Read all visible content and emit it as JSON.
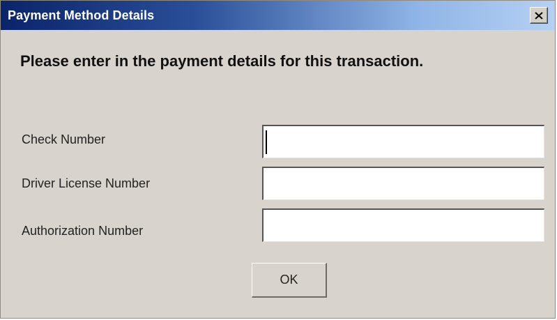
{
  "window": {
    "title": "Payment Method Details",
    "close_icon": "close-icon"
  },
  "content": {
    "heading": "Please enter in the payment details for this transaction.",
    "fields": [
      {
        "label": "Check Number",
        "value": "",
        "focused": true
      },
      {
        "label": "Driver License Number",
        "value": ""
      },
      {
        "label": "Authorization Number",
        "value": ""
      }
    ],
    "ok_label": "OK"
  },
  "colors": {
    "titlebar_start": "#0a246a",
    "titlebar_end": "#b5d0f3",
    "dialog_background": "#d8d4cd",
    "field_background": "#ffffff"
  }
}
